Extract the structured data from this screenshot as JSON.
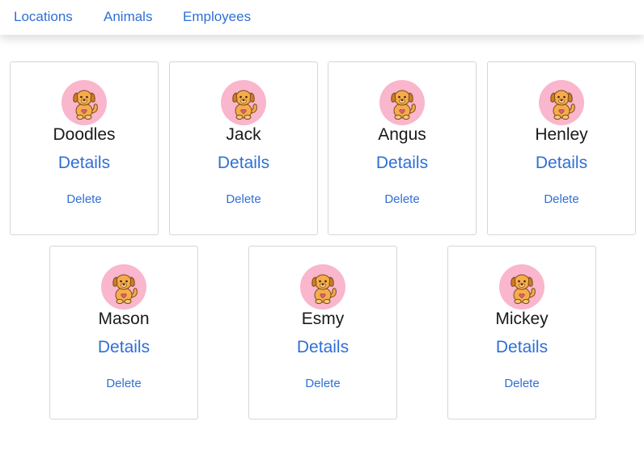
{
  "nav": {
    "items": [
      {
        "label": "Locations"
      },
      {
        "label": "Animals"
      },
      {
        "label": "Employees"
      }
    ]
  },
  "colors": {
    "link": "#2f6fd6",
    "avatar_bg": "#f9b6cc",
    "dog_fur": "#f6ac4b",
    "dog_ear": "#cf7c28",
    "heart": "#e05c8a"
  },
  "animals": [
    {
      "name": "Doodles",
      "details_label": "Details",
      "delete_label": "Delete",
      "icon": "puppy-icon"
    },
    {
      "name": "Jack",
      "details_label": "Details",
      "delete_label": "Delete",
      "icon": "puppy-icon"
    },
    {
      "name": "Angus",
      "details_label": "Details",
      "delete_label": "Delete",
      "icon": "puppy-icon"
    },
    {
      "name": "Henley",
      "details_label": "Details",
      "delete_label": "Delete",
      "icon": "puppy-icon"
    },
    {
      "name": "Mason",
      "details_label": "Details",
      "delete_label": "Delete",
      "icon": "puppy-icon"
    },
    {
      "name": "Esmy",
      "details_label": "Details",
      "delete_label": "Delete",
      "icon": "puppy-icon"
    },
    {
      "name": "Mickey",
      "details_label": "Details",
      "delete_label": "Delete",
      "icon": "puppy-icon"
    }
  ]
}
